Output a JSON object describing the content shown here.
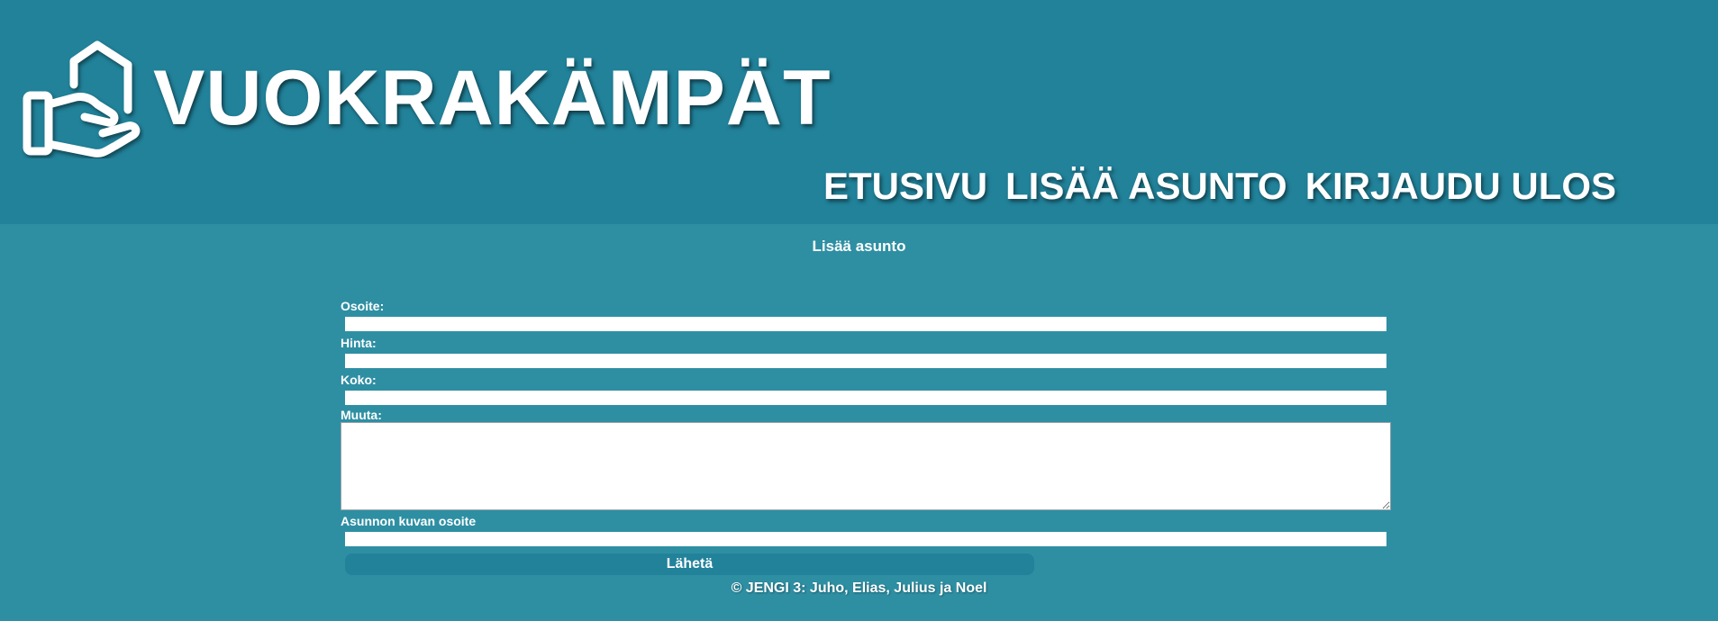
{
  "header": {
    "brand": "VUOKRAKÄMPÄT",
    "logo_icon": "house-in-hand-icon",
    "nav": [
      {
        "label": "ETUSIVU"
      },
      {
        "label": "LISÄÄ ASUNTO"
      },
      {
        "label": "KIRJAUDU ULOS"
      }
    ]
  },
  "page": {
    "heading": "Lisää asunto"
  },
  "form": {
    "address_label": "Osoite:",
    "address_value": "",
    "price_label": "Hinta:",
    "price_value": "",
    "size_label": "Koko:",
    "size_value": "",
    "other_label": "Muuta:",
    "other_value": "",
    "image_url_label": "Asunnon kuvan osoite",
    "image_url_value": "",
    "submit_label": "Lähetä"
  },
  "footer": {
    "text": "© JENGI 3: Juho, Elias, Julius ja Noel"
  },
  "colors": {
    "header_bg": "#21829a",
    "page_bg": "#2e8fa3",
    "button_bg": "#21829a",
    "text": "#ffffff"
  }
}
